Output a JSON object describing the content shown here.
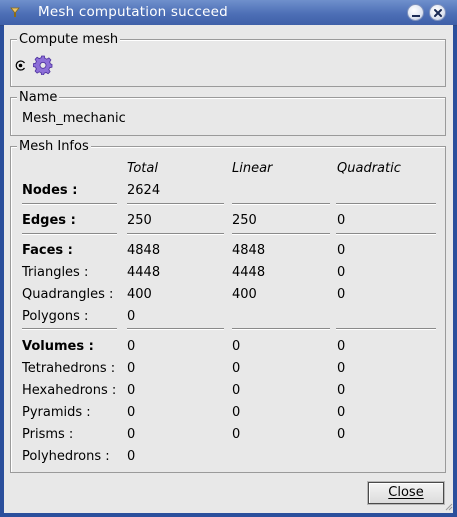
{
  "window": {
    "title": "Mesh computation succeed"
  },
  "compute_mesh": {
    "legend": "Compute mesh",
    "icon": "gear-icon"
  },
  "name_group": {
    "legend": "Name",
    "value": "Mesh_mechanic"
  },
  "mesh_infos": {
    "legend": "Mesh Infos",
    "headers": {
      "total": "Total",
      "linear": "Linear",
      "quadratic": "Quadratic"
    },
    "rows": {
      "nodes": {
        "label": "Nodes :",
        "total": "2624",
        "linear": "",
        "quadratic": ""
      },
      "edges": {
        "label": "Edges :",
        "total": "250",
        "linear": "250",
        "quadratic": "0"
      },
      "faces": {
        "label": "Faces :",
        "total": "4848",
        "linear": "4848",
        "quadratic": "0"
      },
      "triangles": {
        "label": "Triangles :",
        "total": "4448",
        "linear": "4448",
        "quadratic": "0"
      },
      "quadrangles": {
        "label": "Quadrangles :",
        "total": "400",
        "linear": "400",
        "quadratic": "0"
      },
      "polygons": {
        "label": "Polygons :",
        "total": "0",
        "linear": "",
        "quadratic": ""
      },
      "volumes": {
        "label": "Volumes :",
        "total": "0",
        "linear": "0",
        "quadratic": "0"
      },
      "tetrahedrons": {
        "label": "Tetrahedrons :",
        "total": "0",
        "linear": "0",
        "quadratic": "0"
      },
      "hexahedrons": {
        "label": "Hexahedrons :",
        "total": "0",
        "linear": "0",
        "quadratic": "0"
      },
      "pyramids": {
        "label": "Pyramids :",
        "total": "0",
        "linear": "0",
        "quadratic": "0"
      },
      "prisms": {
        "label": "Prisms :",
        "total": "0",
        "linear": "0",
        "quadratic": "0"
      },
      "polyhedrons": {
        "label": "Polyhedrons :",
        "total": "0",
        "linear": "",
        "quadratic": ""
      }
    }
  },
  "buttons": {
    "close": "Close"
  }
}
